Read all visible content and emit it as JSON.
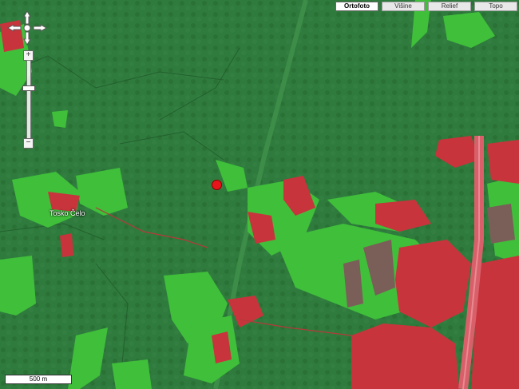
{
  "map": {
    "layers": [
      {
        "label": "Ortofoto",
        "active": true
      },
      {
        "label": "Višine",
        "active": false
      },
      {
        "label": "Relief",
        "active": false
      },
      {
        "label": "Topo",
        "active": false
      }
    ],
    "place_label": "Tosko Čelo",
    "scale_label": "500 m",
    "colors": {
      "forest": "#2e7a3c",
      "grass": "#3fbf3a",
      "urban": "#c8343c",
      "road": "#d9606a"
    }
  },
  "controls": {
    "pan_icon": "pan-arrows-icon",
    "zoom_in": "+",
    "zoom_out": "−"
  }
}
